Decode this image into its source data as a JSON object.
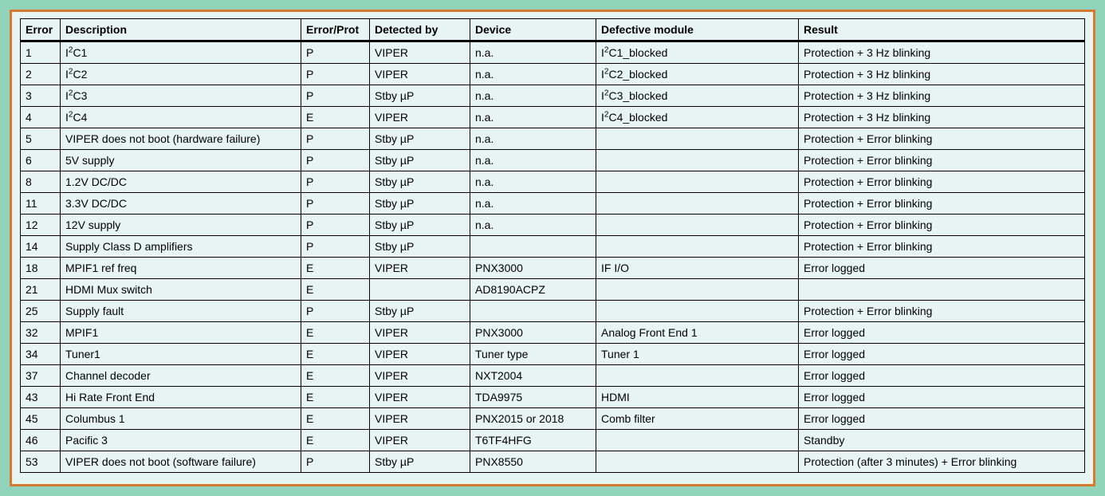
{
  "headers": {
    "error": "Error",
    "description": "Description",
    "errorprot": "Error/Prot",
    "detected": "Detected by",
    "device": "Device",
    "module": "Defective module",
    "result": "Result"
  },
  "rows": [
    {
      "error": "1",
      "description": "I<sup>2</sup>C1",
      "errorprot": "P",
      "detected": "VIPER",
      "device": "n.a.",
      "module": "I<sup>2</sup>C1_blocked",
      "result": "Protection + 3 Hz blinking"
    },
    {
      "error": "2",
      "description": "I<sup>2</sup>C2",
      "errorprot": "P",
      "detected": "VIPER",
      "device": "n.a.",
      "module": "I<sup>2</sup>C2_blocked",
      "result": "Protection + 3 Hz blinking"
    },
    {
      "error": "3",
      "description": "I<sup>2</sup>C3",
      "errorprot": "P",
      "detected": "Stby µP",
      "device": "n.a.",
      "module": "I<sup>2</sup>C3_blocked",
      "result": "Protection + 3 Hz blinking"
    },
    {
      "error": "4",
      "description": "I<sup>2</sup>C4",
      "errorprot": "E",
      "detected": "VIPER",
      "device": "n.a.",
      "module": "I<sup>2</sup>C4_blocked",
      "result": "Protection + 3 Hz blinking"
    },
    {
      "error": "5",
      "description": "VIPER does not boot (hardware failure)",
      "errorprot": "P",
      "detected": "Stby µP",
      "device": "n.a.",
      "module": "",
      "result": "Protection + Error blinking"
    },
    {
      "error": "6",
      "description": "5V supply",
      "errorprot": "P",
      "detected": "Stby µP",
      "device": "n.a.",
      "module": "",
      "result": "Protection + Error blinking"
    },
    {
      "error": "8",
      "description": "1.2V DC/DC",
      "errorprot": "P",
      "detected": "Stby µP",
      "device": "n.a.",
      "module": "",
      "result": "Protection + Error blinking"
    },
    {
      "error": "11",
      "description": "3.3V DC/DC",
      "errorprot": "P",
      "detected": "Stby µP",
      "device": "n.a.",
      "module": "",
      "result": "Protection + Error blinking"
    },
    {
      "error": "12",
      "description": "12V supply",
      "errorprot": "P",
      "detected": "Stby µP",
      "device": "n.a.",
      "module": "",
      "result": "Protection + Error blinking"
    },
    {
      "error": "14",
      "description": "Supply Class D amplifiers",
      "errorprot": "P",
      "detected": "Stby µP",
      "device": "",
      "module": "",
      "result": "Protection + Error blinking"
    },
    {
      "error": "18",
      "description": "MPIF1 ref freq",
      "errorprot": "E",
      "detected": "VIPER",
      "device": "PNX3000",
      "module": "IF I/O",
      "result": "Error logged"
    },
    {
      "error": "21",
      "description": "HDMI Mux switch",
      "errorprot": "E",
      "detected": "",
      "device": "AD8190ACPZ",
      "module": "",
      "result": ""
    },
    {
      "error": "25",
      "description": "Supply fault",
      "errorprot": "P",
      "detected": "Stby µP",
      "device": "",
      "module": "",
      "result": "Protection + Error blinking"
    },
    {
      "error": "32",
      "description": "MPIF1",
      "errorprot": "E",
      "detected": "VIPER",
      "device": "PNX3000",
      "module": "Analog Front End 1",
      "result": "Error logged"
    },
    {
      "error": "34",
      "description": "Tuner1",
      "errorprot": "E",
      "detected": "VIPER",
      "device": "Tuner type",
      "module": "Tuner 1",
      "result": "Error logged"
    },
    {
      "error": "37",
      "description": "Channel decoder",
      "errorprot": "E",
      "detected": "VIPER",
      "device": "NXT2004",
      "module": "",
      "result": "Error logged"
    },
    {
      "error": "43",
      "description": "Hi Rate Front End",
      "errorprot": "E",
      "detected": "VIPER",
      "device": "TDA9975",
      "module": "HDMI",
      "result": "Error logged"
    },
    {
      "error": "45",
      "description": "Columbus 1",
      "errorprot": "E",
      "detected": "VIPER",
      "device": "PNX2015 or 2018",
      "module": "Comb filter",
      "result": "Error logged"
    },
    {
      "error": "46",
      "description": "Pacific 3",
      "errorprot": "E",
      "detected": "VIPER",
      "device": "T6TF4HFG",
      "module": "",
      "result": "Standby"
    },
    {
      "error": "53",
      "description": "VIPER does not boot (software failure)",
      "errorprot": "P",
      "detected": "Stby µP",
      "device": "PNX8550",
      "module": "",
      "result": "Protection (after 3 minutes) + Error blinking"
    }
  ]
}
